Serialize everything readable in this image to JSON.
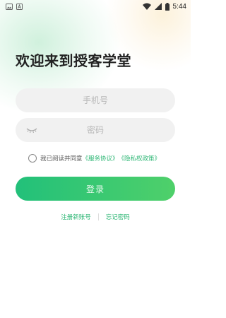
{
  "status_bar": {
    "time": "5:44",
    "icons": [
      "gallery-icon",
      "font-icon",
      "wifi-icon",
      "signal-icon",
      "battery-icon"
    ]
  },
  "page": {
    "title": "欢迎来到授客学堂"
  },
  "form": {
    "phone_placeholder": "手机号",
    "password_placeholder": "密码"
  },
  "agreement": {
    "prefix": "我已阅读并同意",
    "service_link": "《服务协议》",
    "privacy_link": "《隐私权政策》"
  },
  "login_button": "登录",
  "bottom_links": {
    "register": "注册新账号",
    "forgot": "忘记密码"
  },
  "colors": {
    "accent": "#2bb673",
    "button_start": "#22c07a",
    "button_end": "#4fd06a",
    "field_bg": "#f1f1f1"
  }
}
